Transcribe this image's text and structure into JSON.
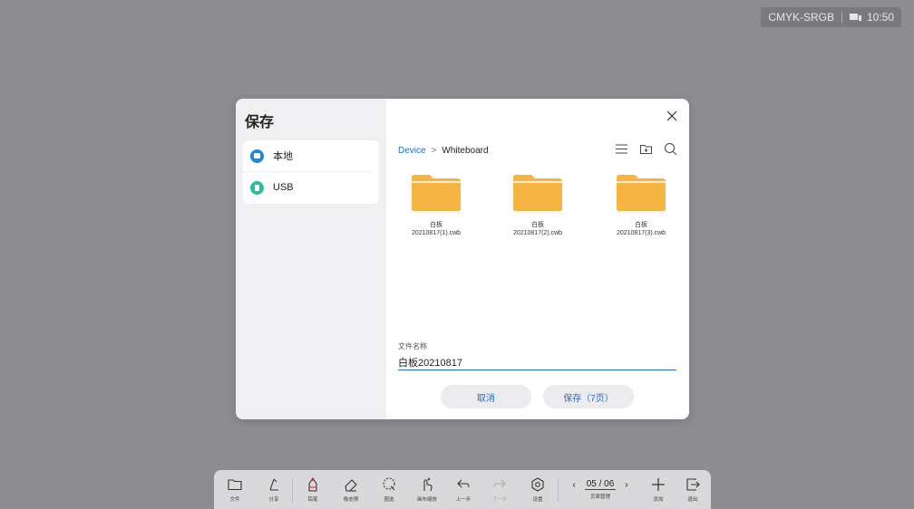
{
  "status_bar": {
    "mode": "CMYK-SRGB",
    "time": "10:50"
  },
  "dialog": {
    "title": "保存",
    "locations": [
      {
        "label": "本地",
        "icon": "folder-icon"
      },
      {
        "label": "USB",
        "icon": "usb-icon"
      }
    ],
    "breadcrumb": {
      "root": "Device",
      "separator": ">",
      "current": "Whiteboard"
    },
    "files": [
      {
        "name_line1": "白板",
        "name_line2": "20210817(1).cwb"
      },
      {
        "name_line1": "白板",
        "name_line2": "20210817(2).cwb"
      },
      {
        "name_line1": "白板",
        "name_line2": "20210817(3).cwb"
      }
    ],
    "filename_label": "文件名称",
    "filename_value": "白板20210817",
    "cancel_label": "取消",
    "save_label": "保存（7页）"
  },
  "toolbar": {
    "file": "文件",
    "share": "分享",
    "pencil": "铅笔",
    "eraser": "橡皮擦",
    "select": "圈选",
    "canvas_zoom": "画布缩放",
    "undo": "上一步",
    "redo": "下一步",
    "settings": "设置",
    "page_number": "05 / 06",
    "page_manage": "页面管理",
    "add": "添加",
    "exit": "退出"
  },
  "colors": {
    "accent": "#1a6fd6",
    "folder": "#f6b443",
    "pencil": "#d23a3a",
    "usb": "#35b8a2",
    "local": "#1e88d8"
  }
}
